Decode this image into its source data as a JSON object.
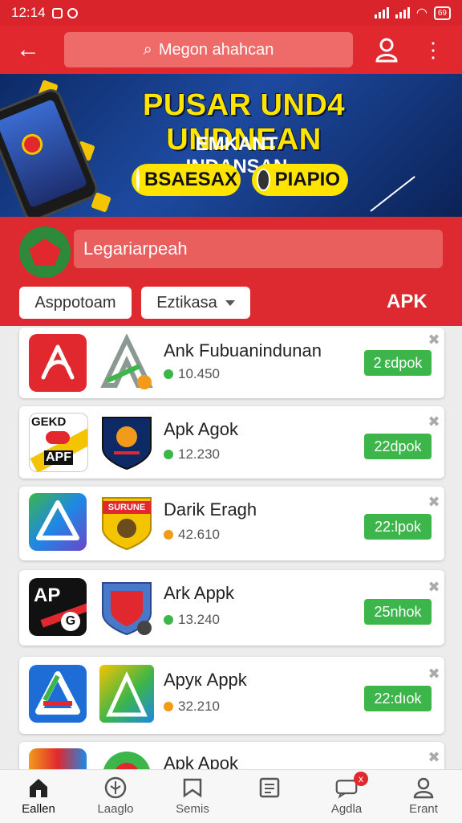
{
  "status": {
    "time": "12:14",
    "battery": "69"
  },
  "search": {
    "placeholder": "Megon ahahcan"
  },
  "banner": {
    "title": "PUSAR UND4 UNDNEAN",
    "subtitle": "EMKANT INDANSAN",
    "pills": [
      {
        "label": "BSAESAX"
      },
      {
        "label": "PIAPIO"
      }
    ]
  },
  "panel": {
    "heading": "Legariarpeah",
    "chip1": "Asppotoam",
    "chip2": "Eztikasa",
    "apk_label": "APK"
  },
  "apps": [
    {
      "name": "Ank Fubuanindunan",
      "count": "10.450",
      "download": "2 εdpok",
      "dot": "#3cb54a"
    },
    {
      "name": "Apk Agok",
      "count": "12.230",
      "download": "22dpok",
      "dot": "#3cb54a"
    },
    {
      "name": "Darik Eragh",
      "count": "42.610",
      "download": "22:lpok",
      "dot": "#f29a1c"
    },
    {
      "name": "Ark Appk",
      "count": "13.240",
      "download": "25nhok",
      "dot": "#3cb54a"
    },
    {
      "name": "Apук Appk",
      "count": "32.210",
      "download": "22:dıok",
      "dot": "#f29a1c"
    },
    {
      "name": "Apk Apok"
    }
  ],
  "icon_labels": {
    "geko": "GEKD",
    "apf": "APF",
    "surune": "SURUNE",
    "ap": "AP"
  },
  "nav": [
    {
      "label": "Eallen",
      "icon": "home-icon"
    },
    {
      "label": "Laaglo",
      "icon": "compass-icon"
    },
    {
      "label": "Semis",
      "icon": "bookmark-icon"
    },
    {
      "label": "",
      "icon": "list-icon"
    },
    {
      "label": "Agdla",
      "icon": "message-icon",
      "badge": "x"
    },
    {
      "label": "Erant",
      "icon": "user-icon"
    }
  ],
  "colors": {
    "brand_red": "#e0282e",
    "download_green": "#3cb54a",
    "banner_yellow": "#ffe400"
  }
}
